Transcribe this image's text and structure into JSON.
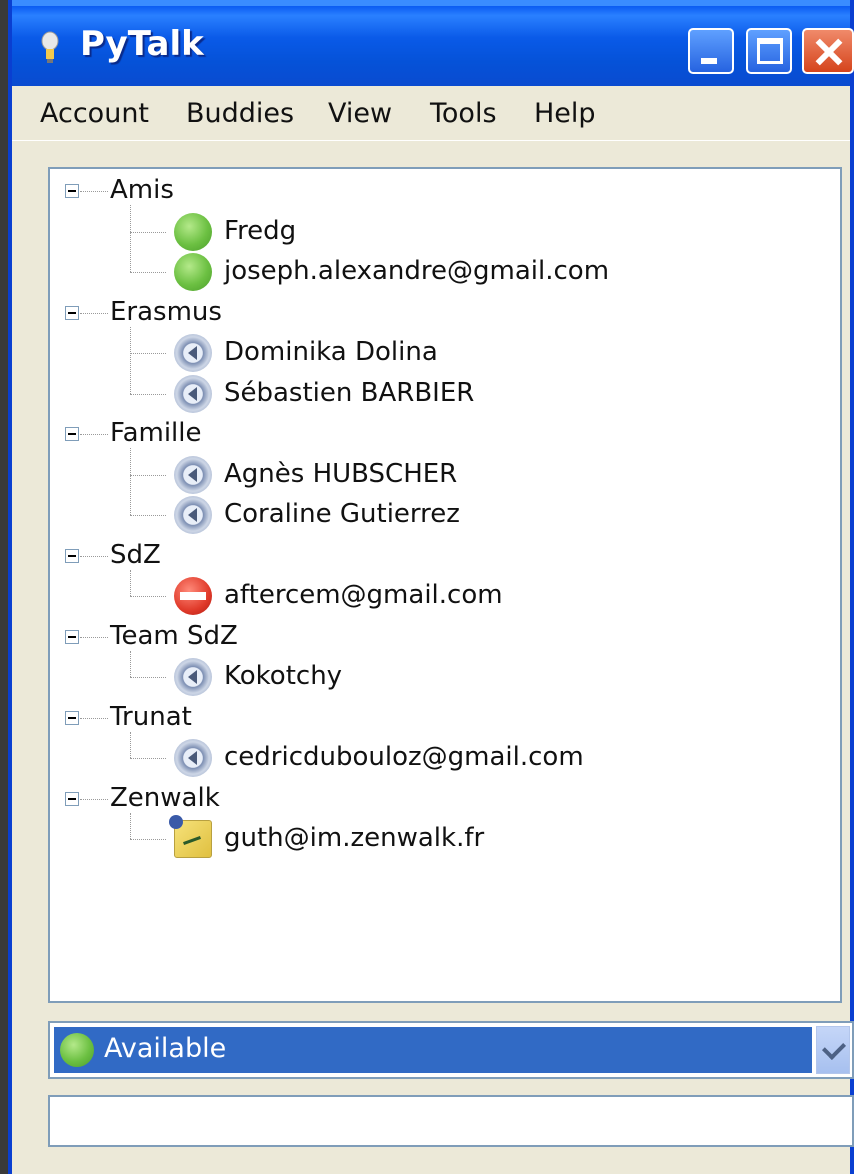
{
  "window": {
    "title": "PyTalk"
  },
  "menu": [
    "Account",
    "Buddies",
    "View",
    "Tools",
    "Help"
  ],
  "groups": [
    {
      "name": "Amis",
      "contacts": [
        {
          "name": "Fredg",
          "status": "available"
        },
        {
          "name": "joseph.alexandre@gmail.com",
          "status": "available"
        }
      ]
    },
    {
      "name": "Erasmus",
      "contacts": [
        {
          "name": "Dominika Dolina",
          "status": "away"
        },
        {
          "name": "Sébastien BARBIER",
          "status": "away"
        }
      ]
    },
    {
      "name": "Famille",
      "contacts": [
        {
          "name": "Agnès HUBSCHER",
          "status": "away"
        },
        {
          "name": "Coraline Gutierrez",
          "status": "away"
        }
      ]
    },
    {
      "name": "SdZ",
      "contacts": [
        {
          "name": "aftercem@gmail.com",
          "status": "busy"
        }
      ]
    },
    {
      "name": "Team SdZ",
      "contacts": [
        {
          "name": "Kokotchy",
          "status": "away"
        }
      ]
    },
    {
      "name": "Trunat",
      "contacts": [
        {
          "name": "cedricdubouloz@gmail.com",
          "status": "away"
        }
      ]
    },
    {
      "name": "Zenwalk",
      "contacts": [
        {
          "name": "guth@im.zenwalk.fr",
          "status": "unknown"
        }
      ]
    }
  ],
  "status_selector": {
    "value": "Available"
  },
  "status_message": {
    "value": ""
  }
}
